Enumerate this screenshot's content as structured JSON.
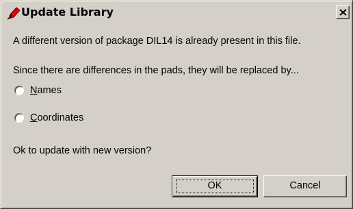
{
  "dialog": {
    "title": "Update Library",
    "icon": "red-pen-icon",
    "close_icon": "close-icon",
    "message_line1": "A different version of package DIL14 is already present in this file.",
    "message_line2": "Since there are differences in the pads, they will be replaced by...",
    "options": [
      {
        "mnemonic": "N",
        "rest": "ames",
        "selected": false
      },
      {
        "mnemonic": "C",
        "rest": "oordinates",
        "selected": false
      }
    ],
    "question": "Ok to update with new version?",
    "ok_label": "OK",
    "cancel_label": "Cancel"
  },
  "colors": {
    "face": "#d4d0c8",
    "icon_red": "#e00000"
  }
}
